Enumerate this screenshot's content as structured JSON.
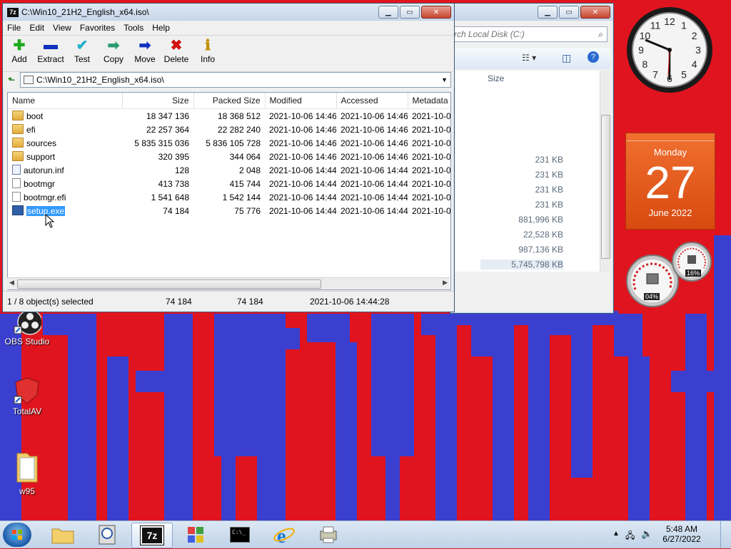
{
  "zip_window": {
    "title": "C:\\Win10_21H2_English_x64.iso\\",
    "menu": [
      "File",
      "Edit",
      "View",
      "Favorites",
      "Tools",
      "Help"
    ],
    "toolbar": [
      {
        "label": "Add",
        "icon": "plus-icon",
        "glyph": "✚",
        "color": "#1faa1f"
      },
      {
        "label": "Extract",
        "icon": "minus-icon",
        "glyph": "▬",
        "color": "#1030c0"
      },
      {
        "label": "Test",
        "icon": "check-icon",
        "glyph": "✔",
        "color": "#20b0c8"
      },
      {
        "label": "Copy",
        "icon": "copy-arrow-icon",
        "glyph": "➡",
        "color": "#2a9a70"
      },
      {
        "label": "Move",
        "icon": "move-arrow-icon",
        "glyph": "➡",
        "color": "#1030c0"
      },
      {
        "label": "Delete",
        "icon": "delete-x-icon",
        "glyph": "✖",
        "color": "#d01010"
      },
      {
        "label": "Info",
        "icon": "info-icon",
        "glyph": "ℹ",
        "color": "#c09000"
      }
    ],
    "address": "C:\\Win10_21H2_English_x64.iso\\",
    "columns": [
      "Name",
      "Size",
      "Packed Size",
      "Modified",
      "Accessed",
      "Metadata"
    ],
    "files": [
      {
        "name": "boot",
        "type": "folder",
        "size": "18 347 136",
        "packed": "18 368 512",
        "modified": "2021-10-06 14:46",
        "accessed": "2021-10-06 14:46",
        "meta": "2021-10-0"
      },
      {
        "name": "efi",
        "type": "folder",
        "size": "22 257 364",
        "packed": "22 282 240",
        "modified": "2021-10-06 14:46",
        "accessed": "2021-10-06 14:46",
        "meta": "2021-10-0"
      },
      {
        "name": "sources",
        "type": "folder",
        "size": "5 835 315 036",
        "packed": "5 836 105 728",
        "modified": "2021-10-06 14:46",
        "accessed": "2021-10-06 14:46",
        "meta": "2021-10-0"
      },
      {
        "name": "support",
        "type": "folder",
        "size": "320 395",
        "packed": "344 064",
        "modified": "2021-10-06 14:46",
        "accessed": "2021-10-06 14:46",
        "meta": "2021-10-0"
      },
      {
        "name": "autorun.inf",
        "type": "inf",
        "size": "128",
        "packed": "2 048",
        "modified": "2021-10-06 14:44",
        "accessed": "2021-10-06 14:44",
        "meta": "2021-10-0"
      },
      {
        "name": "bootmgr",
        "type": "file",
        "size": "413 738",
        "packed": "415 744",
        "modified": "2021-10-06 14:44",
        "accessed": "2021-10-06 14:44",
        "meta": "2021-10-0"
      },
      {
        "name": "bootmgr.efi",
        "type": "file",
        "size": "1 541 648",
        "packed": "1 542 144",
        "modified": "2021-10-06 14:44",
        "accessed": "2021-10-06 14:44",
        "meta": "2021-10-0"
      },
      {
        "name": "setup.exe",
        "type": "exe",
        "size": "74 184",
        "packed": "75 776",
        "modified": "2021-10-06 14:44",
        "accessed": "2021-10-06 14:44",
        "meta": "2021-10-0",
        "selected": true
      }
    ],
    "status": {
      "selection": "1 / 8 object(s) selected",
      "size": "74 184",
      "packed": "74 184",
      "modified": "2021-10-06 14:44:28"
    }
  },
  "explorer_window": {
    "search_placeholder": "rch Local Disk (C:)",
    "size_header": "Size",
    "sizes": [
      "231 KB",
      "231 KB",
      "231 KB",
      "231 KB",
      "881,996 KB",
      "22,528 KB",
      "987,136 KB",
      "5,745,798 KB"
    ]
  },
  "desktop_icons": [
    {
      "label": "OBS Studio",
      "icon": "obs-studio-icon"
    },
    {
      "label": "TotalAV",
      "icon": "totalav-icon"
    },
    {
      "label": "w95",
      "icon": "folder-icon"
    }
  ],
  "gadgets": {
    "clock_numbers": [
      "12",
      "1",
      "2",
      "3",
      "4",
      "5",
      "6",
      "7",
      "8",
      "9",
      "10",
      "11"
    ],
    "calendar": {
      "weekday": "Monday",
      "day": "27",
      "month_year": "June 2022"
    },
    "meter_cpu": "04%",
    "meter_mem": "16%"
  },
  "taskbar": {
    "items": [
      "explorer-icon",
      "disc-burner-icon",
      "7zip-icon",
      "windows-logo-icon",
      "cmd-icon",
      "ie-icon",
      "printer-icon"
    ],
    "zip_label": "7z",
    "cmd_label": "C:\\_",
    "time": "5:48 AM",
    "date": "6/27/2022"
  }
}
